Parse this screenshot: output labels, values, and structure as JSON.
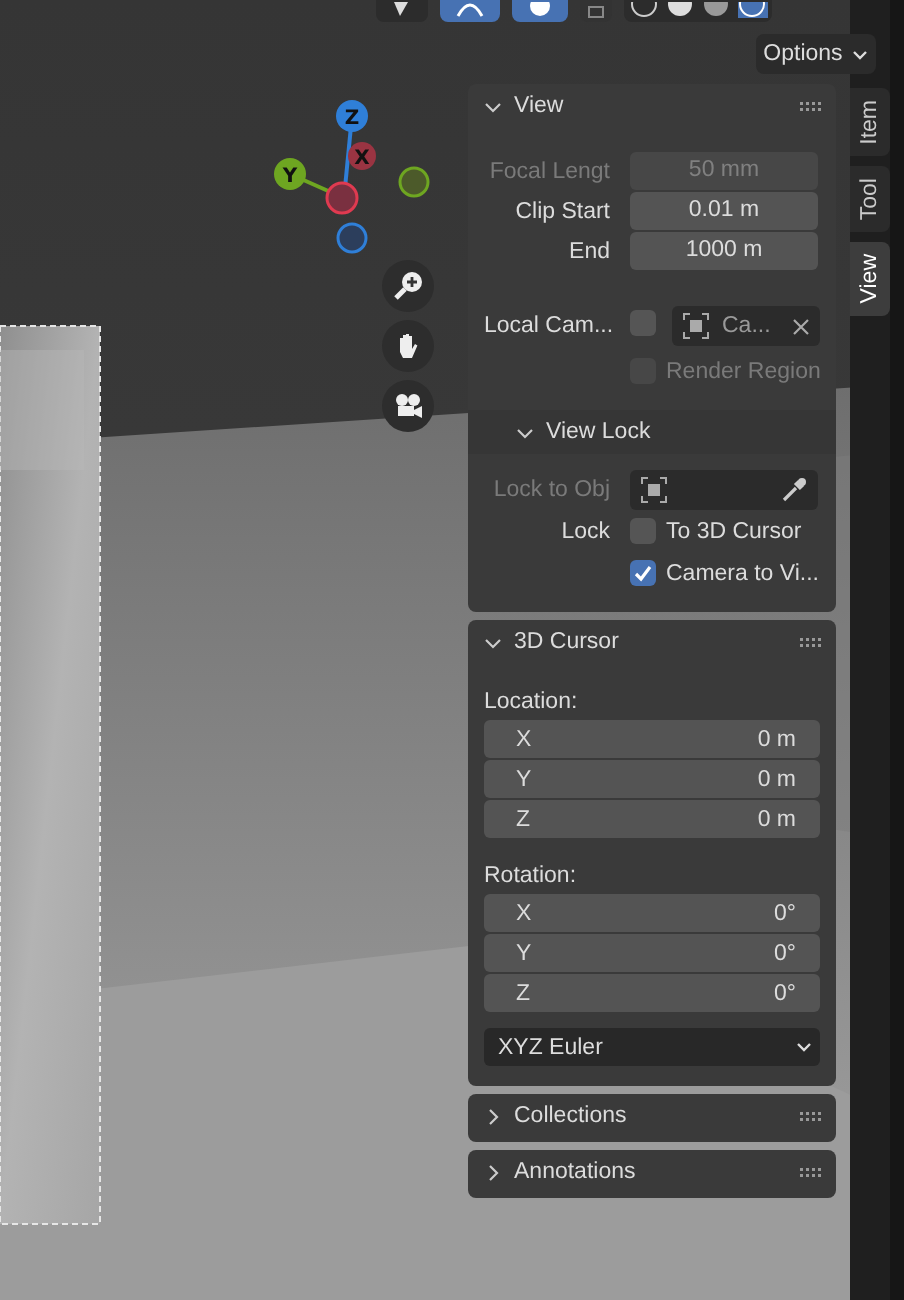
{
  "options_button": "Options",
  "gizmo": [
    {
      "label": "Z"
    },
    {
      "label": "X"
    },
    {
      "label": "Y"
    }
  ],
  "tabs": [
    {
      "label": "Item",
      "selected": false
    },
    {
      "label": "Tool",
      "selected": false
    },
    {
      "label": "View",
      "selected": true
    }
  ],
  "panels": [
    {
      "title": "View",
      "expanded": true,
      "rows": [
        {
          "kind": "number",
          "label": "Focal Lengt",
          "value": "50 mm",
          "disabled": true
        },
        {
          "kind": "number",
          "label": "Clip Start",
          "value": "0.01 m",
          "disabled": false
        },
        {
          "kind": "number",
          "label": "End",
          "value": "1000 m",
          "disabled": false
        },
        {
          "kind": "camera",
          "label": "Local Cam...",
          "checked": false,
          "value": "Ca..."
        },
        {
          "kind": "checkbox",
          "text": "Render Region",
          "checked": false,
          "disabled": true
        },
        {
          "kind": "subheader",
          "title": "View Lock",
          "expanded": true
        },
        {
          "kind": "object",
          "label": "Lock to Obj",
          "disabled": true
        },
        {
          "kind": "checkbox",
          "label": "Lock",
          "text": "To 3D Cursor",
          "checked": false,
          "disabled": false
        },
        {
          "kind": "checkbox",
          "text": "Camera to Vi...",
          "checked": true,
          "disabled": false
        }
      ]
    },
    {
      "title": "3D Cursor",
      "expanded": true,
      "rows": [
        {
          "kind": "caption",
          "text": "Location:"
        },
        {
          "kind": "vector",
          "items": [
            {
              "axis": "X",
              "value": "0 m"
            },
            {
              "axis": "Y",
              "value": "0 m"
            },
            {
              "axis": "Z",
              "value": "0 m"
            }
          ]
        },
        {
          "kind": "caption",
          "text": "Rotation:"
        },
        {
          "kind": "vector",
          "items": [
            {
              "axis": "X",
              "value": "0°"
            },
            {
              "axis": "Y",
              "value": "0°"
            },
            {
              "axis": "Z",
              "value": "0°"
            }
          ]
        },
        {
          "kind": "dropdown",
          "value": "XYZ Euler"
        }
      ]
    },
    {
      "title": "Collections",
      "expanded": false
    },
    {
      "title": "Annotations",
      "expanded": false
    }
  ]
}
